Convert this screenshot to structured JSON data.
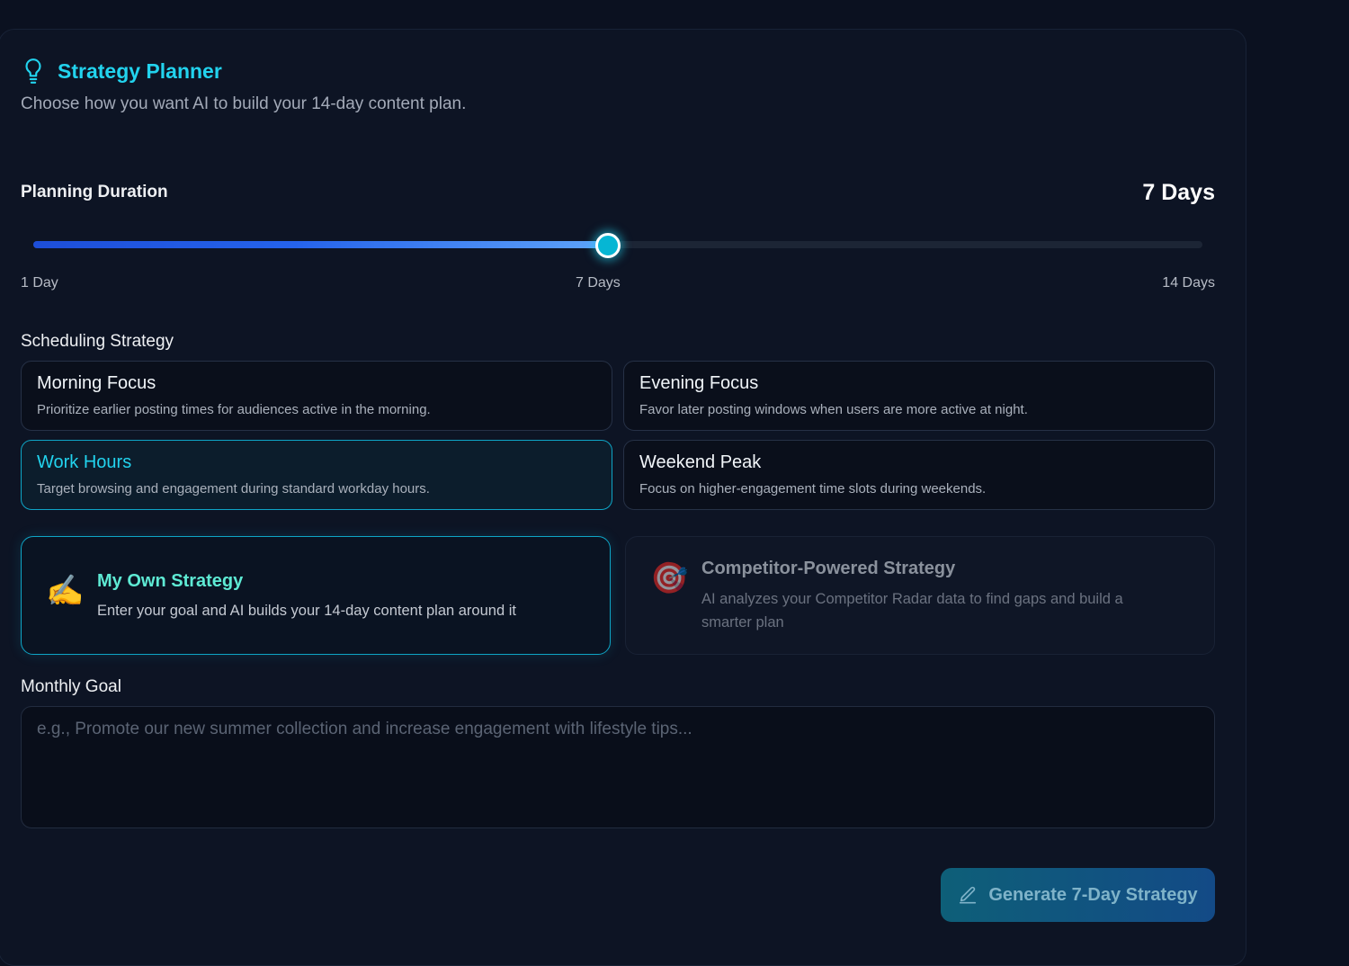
{
  "header": {
    "title": "Strategy Planner",
    "title_icon": "lightbulb-icon",
    "subtitle": "Choose how you want AI to build your 14-day content plan."
  },
  "duration": {
    "label": "Planning Duration",
    "value_text": "7 Days",
    "min": 1,
    "max": 14,
    "value": 7,
    "tick_labels": [
      "1 Day",
      "7 Days",
      "14 Days"
    ]
  },
  "scheduling": {
    "label": "Scheduling Strategy",
    "options": [
      {
        "title": "Morning Focus",
        "desc": "Prioritize earlier posting times for audiences active in the morning.",
        "selected": false
      },
      {
        "title": "Evening Focus",
        "desc": "Favor later posting windows when users are more active at night.",
        "selected": false
      },
      {
        "title": "Work Hours",
        "desc": "Target browsing and engagement during standard workday hours.",
        "selected": true
      },
      {
        "title": "Weekend Peak",
        "desc": "Focus on higher-engagement time slots during weekends.",
        "selected": false
      }
    ]
  },
  "strategy_modes": {
    "own": {
      "emoji": "✍️",
      "icon": "writing-hand-icon",
      "title": "My Own Strategy",
      "desc": "Enter your goal and AI builds your 14-day content plan around it",
      "selected": true
    },
    "competitor": {
      "emoji": "🎯",
      "icon": "target-icon",
      "title": "Competitor-Powered Strategy",
      "desc": "AI analyzes your Competitor Radar data to find gaps and build a smarter plan",
      "selected": false
    }
  },
  "goal": {
    "label": "Monthly Goal",
    "placeholder": "e.g., Promote our new summer collection and increase engagement with lifestyle tips...",
    "value": ""
  },
  "generate_button": {
    "label": "Generate 7-Day Strategy",
    "icon": "pencil-icon"
  },
  "colors": {
    "accent": "#22d3ee",
    "slider_start": "#1d4ed8",
    "slider_end": "#60a5fa",
    "background": "#0b1120"
  }
}
